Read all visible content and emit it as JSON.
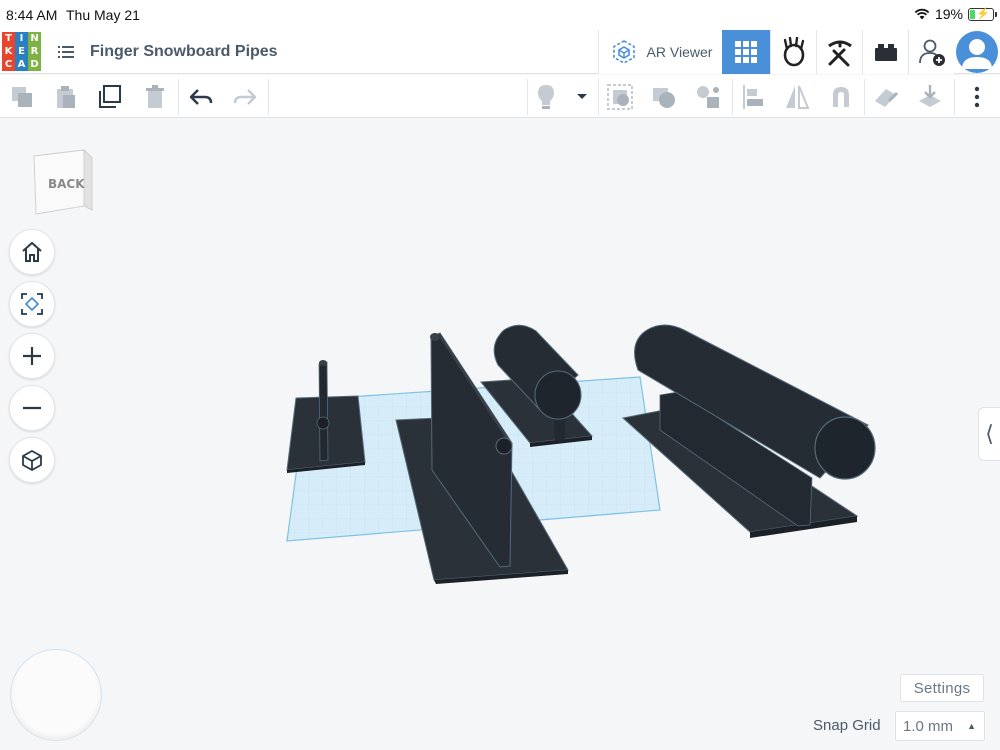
{
  "status_bar": {
    "time": "8:44 AM",
    "date": "Thu May 21",
    "battery": "19%"
  },
  "app": {
    "logo_letters": [
      "T",
      "I",
      "N",
      "K",
      "E",
      "R",
      "C",
      "A",
      "D"
    ],
    "design_title": "Finger Snowboard Pipes",
    "ar_viewer_label": "AR Viewer"
  },
  "header_icons": [
    "grid-view-icon",
    "brick-person-icon",
    "pickaxe-icon",
    "brick-icon",
    "add-user-icon",
    "profile-avatar-icon"
  ],
  "toolbar_icons": [
    "copy-icon",
    "paste-icon",
    "duplicate-icon",
    "delete-icon",
    "undo-icon",
    "redo-icon",
    "note-icon",
    "dropdown-icon",
    "group-icon",
    "ungroup-icon",
    "cruise-icon",
    "align-icon",
    "mirror-icon",
    "magnet-icon",
    "import-icon",
    "export-icon",
    "more-icon"
  ],
  "viewcube": {
    "face_label": "BACK"
  },
  "workplane": {
    "settings_label": "Settings",
    "snap_grid_label": "Snap Grid",
    "snap_grid_value": "1.0 mm"
  },
  "colors": {
    "accent": "#4a90d9",
    "shape": "#2a2f35",
    "workplane": "#cfe9f7",
    "toolbar_icon": "#9aa5b0"
  }
}
